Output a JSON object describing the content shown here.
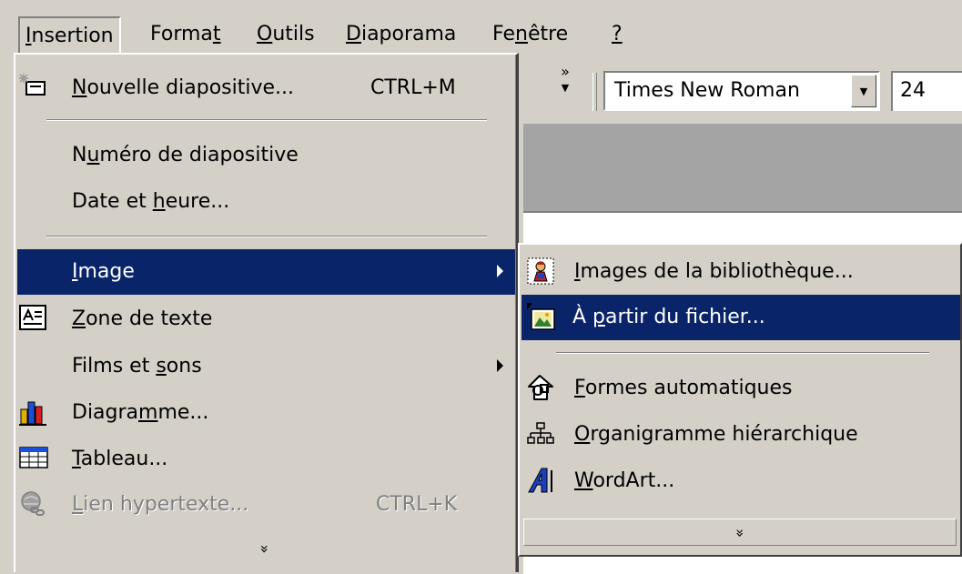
{
  "menubar": {
    "items": [
      {
        "pre": "",
        "m": "I",
        "post": "nsertion"
      },
      {
        "pre": "Forma",
        "m": "t",
        "post": ""
      },
      {
        "pre": "",
        "m": "O",
        "post": "utils"
      },
      {
        "pre": "",
        "m": "D",
        "post": "iaporama"
      },
      {
        "pre": "Fe",
        "m": "n",
        "post": "être"
      },
      {
        "pre": "",
        "m": "?",
        "post": ""
      }
    ]
  },
  "toolbar": {
    "chevron": "»",
    "font": "Times New Roman",
    "size": "24"
  },
  "insertion_menu": {
    "items": [
      {
        "pre": "",
        "m": "N",
        "post": "ouvelle diapositive...",
        "shortcut": "CTRL+M",
        "icon": "new-slide-icon"
      },
      {
        "pre": "N",
        "m": "u",
        "post": "méro de diapositive",
        "shortcut": "",
        "icon": ""
      },
      {
        "pre": "Date et ",
        "m": "h",
        "post": "eure...",
        "shortcut": "",
        "icon": ""
      },
      {
        "pre": "",
        "m": "I",
        "post": "mage",
        "shortcut": "",
        "icon": ""
      },
      {
        "pre": "",
        "m": "Z",
        "post": "one de texte",
        "shortcut": "",
        "icon": "text-box-icon"
      },
      {
        "pre": "Films et ",
        "m": "s",
        "post": "ons",
        "shortcut": "",
        "icon": ""
      },
      {
        "pre": "Diagra",
        "m": "m",
        "post": "me...",
        "shortcut": "",
        "icon": "chart-icon"
      },
      {
        "pre": "",
        "m": "T",
        "post": "ableau...",
        "shortcut": "",
        "icon": "table-icon"
      },
      {
        "pre": "",
        "m": "L",
        "post": "ien hypertexte...",
        "shortcut": "CTRL+K",
        "icon": "hyperlink-icon"
      }
    ],
    "more": "»"
  },
  "image_submenu": {
    "items": [
      {
        "pre": "",
        "m": "I",
        "post": "mages de la bibliothèque...",
        "icon": "clipart-icon"
      },
      {
        "pre": "À ",
        "m": "p",
        "post": "artir du fichier...",
        "icon": "picture-from-file-icon"
      },
      {
        "pre": "",
        "m": "F",
        "post": "ormes automatiques",
        "icon": "autoshapes-icon"
      },
      {
        "pre": "",
        "m": "O",
        "post": "rganigramme hiérarchique",
        "icon": "org-chart-icon"
      },
      {
        "pre": "",
        "m": "W",
        "post": "ordArt...",
        "icon": "wordart-icon"
      }
    ],
    "more": "»"
  },
  "colors": {
    "face": "#d4d0c8",
    "highlight": "#0a246a",
    "band": "#a4a4a4"
  }
}
